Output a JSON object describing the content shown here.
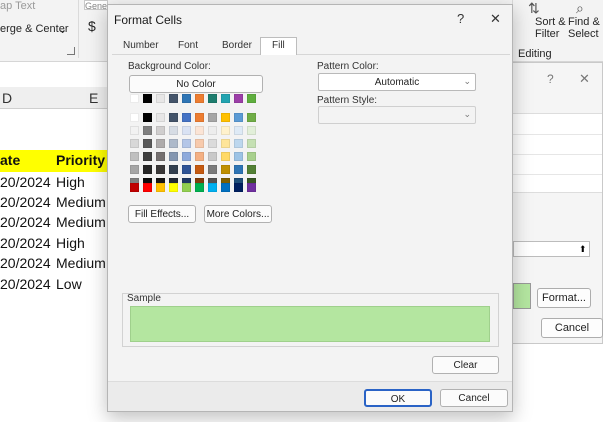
{
  "ribbon": {
    "wrap_text": "ap Text",
    "merge_center": "erge & Center",
    "number_format": "General",
    "currency_symbol": "$",
    "sort_filter_line1": "Sort &",
    "sort_filter_line2": "Filter",
    "find_select_line1": "Find &",
    "find_select_line2": "Select",
    "editing_group": "Editing"
  },
  "sheet": {
    "col_d": "D",
    "col_e": "E",
    "header_date": "ate",
    "header_priority": "Priority",
    "rows": [
      {
        "date": "20/2024",
        "priority": "High"
      },
      {
        "date": "20/2024",
        "priority": "Medium"
      },
      {
        "date": "20/2024",
        "priority": "Medium"
      },
      {
        "date": "20/2024",
        "priority": "High"
      },
      {
        "date": "20/2024",
        "priority": "Medium"
      },
      {
        "date": "20/2024",
        "priority": "Low"
      }
    ]
  },
  "bg_dialog": {
    "help": "?",
    "close": "✕",
    "up_arrow": "⬆",
    "format_label": "Format...",
    "cancel_label": "Cancel"
  },
  "dialog": {
    "title": "Format Cells",
    "help": "?",
    "close": "✕",
    "tabs": [
      "Number",
      "Font",
      "Border",
      "Fill"
    ],
    "active_tab": "Fill",
    "background_color_label": "Background Color:",
    "no_color": "No Color",
    "fill_effects": "Fill Effects...",
    "more_colors": "More Colors...",
    "pattern_color_label": "Pattern Color:",
    "pattern_color_value": "Automatic",
    "pattern_style_label": "Pattern Style:",
    "pattern_style_value": "",
    "sample_label": "Sample",
    "sample_color": "#b4e6a0",
    "clear": "Clear",
    "ok": "OK",
    "cancel": "Cancel",
    "theme_colors": [
      [
        "#ffffff",
        "#000000",
        "#e7e6e6",
        "#44546a",
        "#4472c4",
        "#ed7d31",
        "#a5a5a5",
        "#ffc000",
        "#5b9bd5",
        "#70ad47"
      ],
      [
        "#f2f2f2",
        "#7f7f7f",
        "#d0cece",
        "#d6dce4",
        "#d9e2f3",
        "#fbe4d5",
        "#ededed",
        "#fff2cc",
        "#deeaf6",
        "#e2efd9"
      ],
      [
        "#d8d8d8",
        "#595959",
        "#aeabab",
        "#adb9ca",
        "#b4c6e7",
        "#f7caac",
        "#dbdbdb",
        "#fee599",
        "#bdd7ee",
        "#c5e0b3"
      ],
      [
        "#bfbfbf",
        "#3f3f3f",
        "#757070",
        "#8496b0",
        "#8eaadb",
        "#f4b083",
        "#c9c9c9",
        "#ffd965",
        "#9cc3e5",
        "#a8d08d"
      ],
      [
        "#a5a5a5",
        "#262626",
        "#3a3838",
        "#323f4f",
        "#2f5496",
        "#c55a11",
        "#7b7b7b",
        "#bf9000",
        "#2e75b5",
        "#538135"
      ],
      [
        "#7f7f7f",
        "#0c0c0c",
        "#171616",
        "#222a35",
        "#1f3864",
        "#833c0b",
        "#525252",
        "#7f6000",
        "#1e4e79",
        "#375623"
      ]
    ],
    "top_colors": [
      "#ffffff",
      "#000000",
      "#e7e6e6",
      "#44546a",
      "#2e75b5",
      "#ed7d31",
      "#1e7d6e",
      "#22a3b0",
      "#9c3fa8",
      "#5fae3e"
    ],
    "standard_colors": [
      "#c00000",
      "#ff0000",
      "#ffc000",
      "#ffff00",
      "#92d050",
      "#00b050",
      "#00b0f0",
      "#0070c0",
      "#002060",
      "#7030a0"
    ]
  }
}
